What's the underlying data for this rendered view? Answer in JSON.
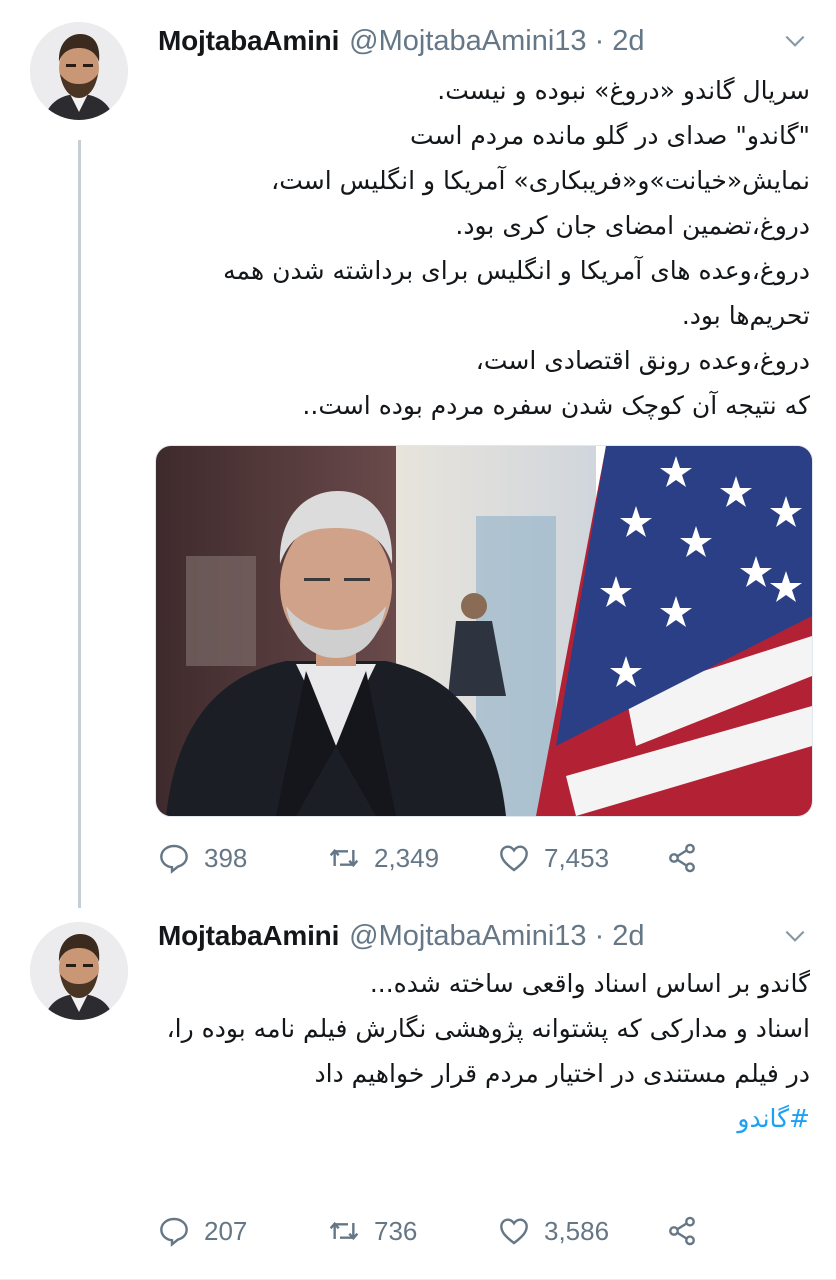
{
  "tweets": [
    {
      "author": {
        "name": "MojtabaAmini",
        "handle": "@MojtabaAmini13",
        "time": "2d"
      },
      "lines": [
        "سریال گاندو «دروغ» نبوده و نیست.",
        "\"گاندو\" صدای در گلو مانده مردم است",
        "نمایش«خیانت»و«فریبکاری» آمریکا و انگلیس است،",
        "دروغ،تضمین امضای جان کری بود.",
        "دروغ،وعده های آمریکا و انگلیس برای برداشته شدن همه تحریم‌ها بود.",
        "دروغ،وعده رونق اقتصادی است،",
        "که نتیجه آن کوچک شدن سفره مردم بوده است.."
      ],
      "stats": {
        "replies": "398",
        "retweets": "2,349",
        "likes": "7,453"
      }
    },
    {
      "author": {
        "name": "MojtabaAmini",
        "handle": "@MojtabaAmini13",
        "time": "2d"
      },
      "lines": [
        "گاندو بر اساس اسناد واقعی ساخته شده...",
        "اسناد و مدارکی که پشتوانه پژوهشی نگارش فیلم نامه  بوده را،",
        "در فیلم مستندی در اختیار مردم قرار خواهیم داد"
      ],
      "hashtag": "#گاندو",
      "stats": {
        "replies": "207",
        "retweets": "736",
        "likes": "3,586"
      }
    }
  ],
  "colors": {
    "link": "#1da1f2",
    "muted": "#657786",
    "text": "#14171a"
  },
  "icons": [
    "reply-icon",
    "retweet-icon",
    "like-icon",
    "share-icon",
    "chevron-down-icon"
  ]
}
